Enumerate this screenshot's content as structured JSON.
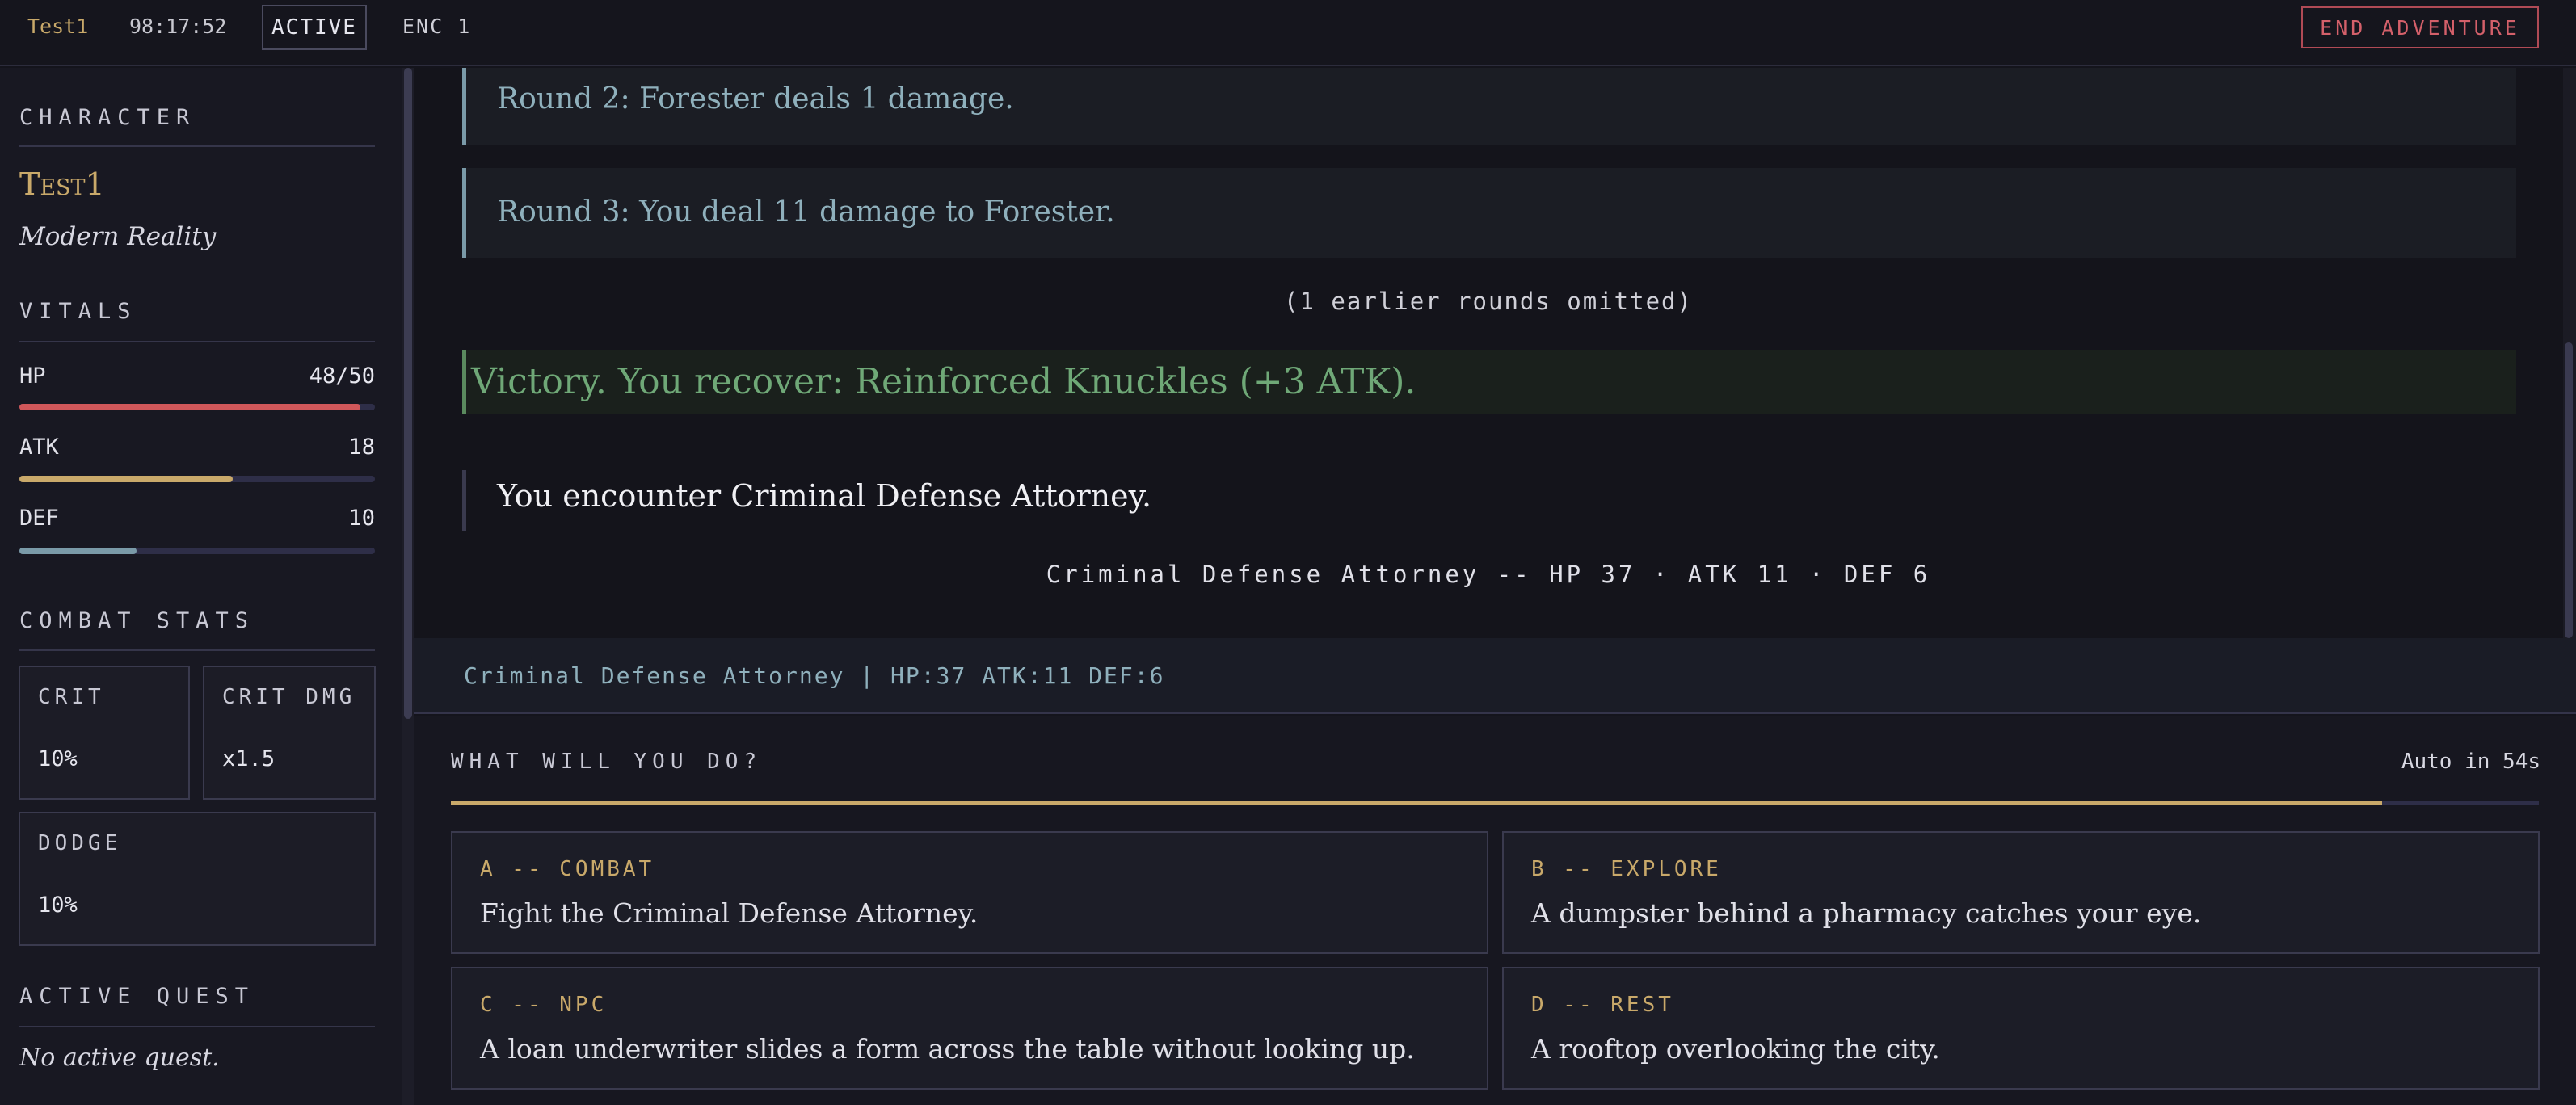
{
  "topbar": {
    "character": "Test1",
    "clock": "98:17:52",
    "status": "ACTIVE",
    "encounter": "ENC 1",
    "end_label": "END ADVENTURE"
  },
  "sidebar": {
    "character_title": "CHARACTER",
    "name": "Test1",
    "world": "Modern Reality",
    "vitals_title": "VITALS",
    "vitals": [
      {
        "label": "HP",
        "value": "48/50",
        "fill": 0.96,
        "color": "#d0575a"
      },
      {
        "label": "ATK",
        "value": "18",
        "fill": 0.6,
        "color": "#c9a96a"
      },
      {
        "label": "DEF",
        "value": "10",
        "fill": 0.33,
        "color": "#7a9aa8"
      }
    ],
    "combat_title": "COMBAT STATS",
    "combat": [
      {
        "label": "CRIT",
        "value": "10%"
      },
      {
        "label": "CRIT DMG",
        "value": "x1.5"
      },
      {
        "label": "DODGE",
        "value": "10%"
      }
    ],
    "quest_title": "ACTIVE QUEST",
    "quest_text": "No active quest."
  },
  "log": {
    "rounds": [
      "Round 2: Forester deals 1 damage.",
      "Round 3: You deal 11 damage to Forester."
    ],
    "omitted": "(1 earlier rounds omitted)",
    "victory": "Victory. You recover: Reinforced Knuckles (+3 ATK).",
    "encounter": "You encounter Criminal Defense Attorney.",
    "enemy_line": "Criminal Defense Attorney -- HP 37 · ATK 11 · DEF 6"
  },
  "enemy_bar": "Criminal Defense Attorney | HP:37 ATK:11 DEF:6",
  "actions": {
    "title": "WHAT WILL YOU DO?",
    "auto": "Auto in 54s",
    "timer_fill": 0.925,
    "choices": [
      {
        "tag": "A -- COMBAT",
        "text": "Fight the Criminal Defense Attorney."
      },
      {
        "tag": "B -- EXPLORE",
        "text": "A dumpster behind a pharmacy catches your eye."
      },
      {
        "tag": "C -- NPC",
        "text": "A loan underwriter slides a form across the table without looking up."
      },
      {
        "tag": "D -- REST",
        "text": "A rooftop overlooking the city."
      }
    ]
  }
}
